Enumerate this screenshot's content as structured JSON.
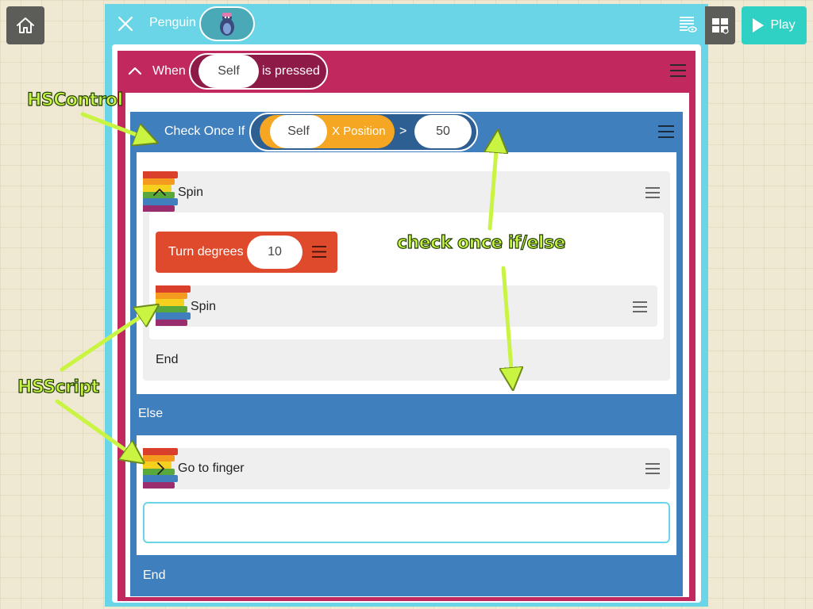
{
  "header": {
    "object_name": "Penguin",
    "play_label": "Play"
  },
  "rule": {
    "when_label": "When",
    "self_label": "Self",
    "event_label": "is pressed"
  },
  "control": {
    "label": "Check Once If",
    "left_object": "Self",
    "left_property": "X Position",
    "operator": ">",
    "right_value": "50",
    "else_label": "Else",
    "end_label": "End"
  },
  "if_branch": {
    "ability_name": "Spin",
    "turn_label": "Turn degrees",
    "turn_value": "10",
    "nested_ability_name": "Spin",
    "end_label": "End"
  },
  "else_branch": {
    "ability_name": "Go to finger"
  },
  "annotations": {
    "hscontrol": "HSControl",
    "check_once": "check once if/else",
    "hsscript": "HSScript"
  },
  "colors": {
    "panel": "#69d5e6",
    "rule": "#c0285e",
    "control": "#3f7fbd",
    "turn_block": "#e04a2c",
    "play": "#2fd1c4",
    "annotation": "#c9f542"
  },
  "icons": {
    "home": "home-icon",
    "close": "close-icon",
    "list": "list-eye-icon",
    "grid": "grid-icon",
    "play": "play-icon",
    "menu": "hamburger-icon",
    "ability": "rainbow-ability-icon"
  }
}
